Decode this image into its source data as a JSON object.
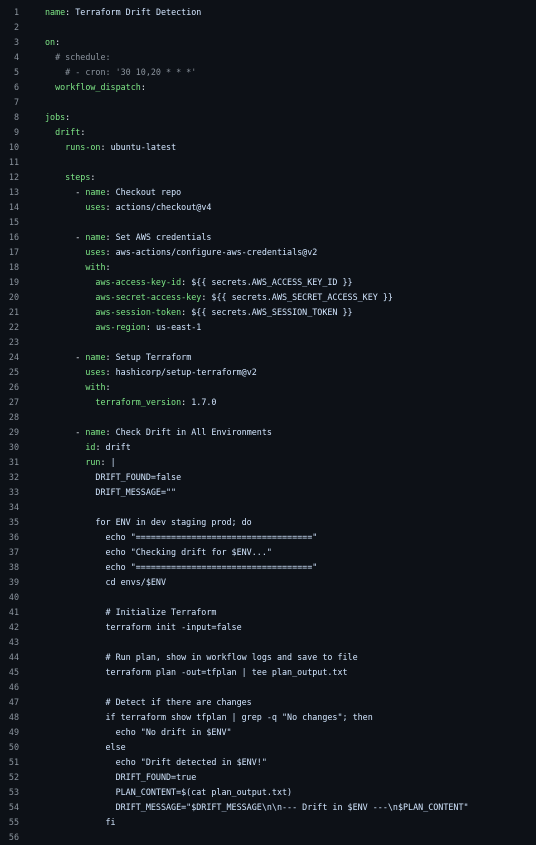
{
  "editor": {
    "lines": [
      {
        "n": "1",
        "t": [
          {
            "c": "k",
            "s": "name"
          },
          {
            "c": "p",
            "s": ": "
          },
          {
            "c": "v",
            "s": "Terraform Drift Detection"
          }
        ]
      },
      {
        "n": "2",
        "t": []
      },
      {
        "n": "3",
        "t": [
          {
            "c": "k",
            "s": "on"
          },
          {
            "c": "p",
            "s": ":"
          }
        ]
      },
      {
        "n": "4",
        "t": [
          {
            "c": "c",
            "s": "  # schedule:"
          }
        ]
      },
      {
        "n": "5",
        "t": [
          {
            "c": "c",
            "s": "    # - cron: '30 10,20 * * *'"
          }
        ]
      },
      {
        "n": "6",
        "t": [
          {
            "c": "p",
            "s": "  "
          },
          {
            "c": "k",
            "s": "workflow_dispatch"
          },
          {
            "c": "p",
            "s": ":"
          }
        ]
      },
      {
        "n": "7",
        "t": []
      },
      {
        "n": "8",
        "t": [
          {
            "c": "k",
            "s": "jobs"
          },
          {
            "c": "p",
            "s": ":"
          }
        ]
      },
      {
        "n": "9",
        "t": [
          {
            "c": "p",
            "s": "  "
          },
          {
            "c": "k",
            "s": "drift"
          },
          {
            "c": "p",
            "s": ":"
          }
        ]
      },
      {
        "n": "10",
        "t": [
          {
            "c": "p",
            "s": "    "
          },
          {
            "c": "k",
            "s": "runs-on"
          },
          {
            "c": "p",
            "s": ": "
          },
          {
            "c": "v",
            "s": "ubuntu-latest"
          }
        ]
      },
      {
        "n": "11",
        "t": []
      },
      {
        "n": "12",
        "t": [
          {
            "c": "p",
            "s": "    "
          },
          {
            "c": "k",
            "s": "steps"
          },
          {
            "c": "p",
            "s": ":"
          }
        ]
      },
      {
        "n": "13",
        "t": [
          {
            "c": "p",
            "s": "      - "
          },
          {
            "c": "k",
            "s": "name"
          },
          {
            "c": "p",
            "s": ": "
          },
          {
            "c": "v",
            "s": "Checkout repo"
          }
        ]
      },
      {
        "n": "14",
        "t": [
          {
            "c": "p",
            "s": "        "
          },
          {
            "c": "k",
            "s": "uses"
          },
          {
            "c": "p",
            "s": ": "
          },
          {
            "c": "v",
            "s": "actions/checkout@v4"
          }
        ]
      },
      {
        "n": "15",
        "t": []
      },
      {
        "n": "16",
        "t": [
          {
            "c": "p",
            "s": "      - "
          },
          {
            "c": "k",
            "s": "name"
          },
          {
            "c": "p",
            "s": ": "
          },
          {
            "c": "v",
            "s": "Set AWS credentials"
          }
        ]
      },
      {
        "n": "17",
        "t": [
          {
            "c": "p",
            "s": "        "
          },
          {
            "c": "k",
            "s": "uses"
          },
          {
            "c": "p",
            "s": ": "
          },
          {
            "c": "v",
            "s": "aws-actions/configure-aws-credentials@v2"
          }
        ]
      },
      {
        "n": "18",
        "t": [
          {
            "c": "p",
            "s": "        "
          },
          {
            "c": "k",
            "s": "with"
          },
          {
            "c": "p",
            "s": ":"
          }
        ]
      },
      {
        "n": "19",
        "t": [
          {
            "c": "p",
            "s": "          "
          },
          {
            "c": "k",
            "s": "aws-access-key-id"
          },
          {
            "c": "p",
            "s": ": "
          },
          {
            "c": "v",
            "s": "${{ secrets.AWS_ACCESS_KEY_ID }}"
          }
        ]
      },
      {
        "n": "20",
        "t": [
          {
            "c": "p",
            "s": "          "
          },
          {
            "c": "k",
            "s": "aws-secret-access-key"
          },
          {
            "c": "p",
            "s": ": "
          },
          {
            "c": "v",
            "s": "${{ secrets.AWS_SECRET_ACCESS_KEY }}"
          }
        ]
      },
      {
        "n": "21",
        "t": [
          {
            "c": "p",
            "s": "          "
          },
          {
            "c": "k",
            "s": "aws-session-token"
          },
          {
            "c": "p",
            "s": ": "
          },
          {
            "c": "v",
            "s": "${{ secrets.AWS_SESSION_TOKEN }}"
          }
        ]
      },
      {
        "n": "22",
        "t": [
          {
            "c": "p",
            "s": "          "
          },
          {
            "c": "k",
            "s": "aws-region"
          },
          {
            "c": "p",
            "s": ": "
          },
          {
            "c": "v",
            "s": "us-east-1"
          }
        ]
      },
      {
        "n": "23",
        "t": []
      },
      {
        "n": "24",
        "t": [
          {
            "c": "p",
            "s": "      - "
          },
          {
            "c": "k",
            "s": "name"
          },
          {
            "c": "p",
            "s": ": "
          },
          {
            "c": "v",
            "s": "Setup Terraform"
          }
        ]
      },
      {
        "n": "25",
        "t": [
          {
            "c": "p",
            "s": "        "
          },
          {
            "c": "k",
            "s": "uses"
          },
          {
            "c": "p",
            "s": ": "
          },
          {
            "c": "v",
            "s": "hashicorp/setup-terraform@v2"
          }
        ]
      },
      {
        "n": "26",
        "t": [
          {
            "c": "p",
            "s": "        "
          },
          {
            "c": "k",
            "s": "with"
          },
          {
            "c": "p",
            "s": ":"
          }
        ]
      },
      {
        "n": "27",
        "t": [
          {
            "c": "p",
            "s": "          "
          },
          {
            "c": "k",
            "s": "terraform_version"
          },
          {
            "c": "p",
            "s": ": "
          },
          {
            "c": "v",
            "s": "1.7.0"
          }
        ]
      },
      {
        "n": "28",
        "t": []
      },
      {
        "n": "29",
        "t": [
          {
            "c": "p",
            "s": "      - "
          },
          {
            "c": "k",
            "s": "name"
          },
          {
            "c": "p",
            "s": ": "
          },
          {
            "c": "v",
            "s": "Check Drift in All Environments"
          }
        ]
      },
      {
        "n": "30",
        "t": [
          {
            "c": "p",
            "s": "        "
          },
          {
            "c": "k",
            "s": "id"
          },
          {
            "c": "p",
            "s": ": "
          },
          {
            "c": "v",
            "s": "drift"
          }
        ]
      },
      {
        "n": "31",
        "t": [
          {
            "c": "p",
            "s": "        "
          },
          {
            "c": "k",
            "s": "run"
          },
          {
            "c": "p",
            "s": ": "
          },
          {
            "c": "v",
            "s": "|"
          }
        ]
      },
      {
        "n": "32",
        "t": [
          {
            "c": "v",
            "s": "          DRIFT_FOUND=false"
          }
        ]
      },
      {
        "n": "33",
        "t": [
          {
            "c": "v",
            "s": "          DRIFT_MESSAGE=\"\""
          }
        ]
      },
      {
        "n": "34",
        "t": []
      },
      {
        "n": "35",
        "t": [
          {
            "c": "v",
            "s": "          for ENV in dev staging prod; do"
          }
        ]
      },
      {
        "n": "36",
        "t": [
          {
            "c": "v",
            "s": "            echo \"===================================\""
          }
        ]
      },
      {
        "n": "37",
        "t": [
          {
            "c": "v",
            "s": "            echo \"Checking drift for $ENV...\""
          }
        ]
      },
      {
        "n": "38",
        "t": [
          {
            "c": "v",
            "s": "            echo \"===================================\""
          }
        ]
      },
      {
        "n": "39",
        "t": [
          {
            "c": "v",
            "s": "            cd envs/$ENV"
          }
        ]
      },
      {
        "n": "40",
        "t": []
      },
      {
        "n": "41",
        "t": [
          {
            "c": "v",
            "s": "            # Initialize Terraform"
          }
        ]
      },
      {
        "n": "42",
        "t": [
          {
            "c": "v",
            "s": "            terraform init -input=false"
          }
        ]
      },
      {
        "n": "43",
        "t": []
      },
      {
        "n": "44",
        "t": [
          {
            "c": "v",
            "s": "            # Run plan, show in workflow logs and save to file"
          }
        ]
      },
      {
        "n": "45",
        "t": [
          {
            "c": "v",
            "s": "            terraform plan -out=tfplan | tee plan_output.txt"
          }
        ]
      },
      {
        "n": "46",
        "t": []
      },
      {
        "n": "47",
        "t": [
          {
            "c": "v",
            "s": "            # Detect if there are changes"
          }
        ]
      },
      {
        "n": "48",
        "t": [
          {
            "c": "v",
            "s": "            if terraform show tfplan | grep -q \"No changes\"; then"
          }
        ]
      },
      {
        "n": "49",
        "t": [
          {
            "c": "v",
            "s": "              echo \"No drift in $ENV\""
          }
        ]
      },
      {
        "n": "50",
        "t": [
          {
            "c": "v",
            "s": "            else"
          }
        ]
      },
      {
        "n": "51",
        "t": [
          {
            "c": "v",
            "s": "              echo \"Drift detected in $ENV!\""
          }
        ]
      },
      {
        "n": "52",
        "t": [
          {
            "c": "v",
            "s": "              DRIFT_FOUND=true"
          }
        ]
      },
      {
        "n": "53",
        "t": [
          {
            "c": "v",
            "s": "              PLAN_CONTENT=$(cat plan_output.txt)"
          }
        ]
      },
      {
        "n": "54",
        "t": [
          {
            "c": "v",
            "s": "              DRIFT_MESSAGE=\"$DRIFT_MESSAGE\\n\\n--- Drift in $ENV ---\\n$PLAN_CONTENT\""
          }
        ]
      },
      {
        "n": "55",
        "t": [
          {
            "c": "v",
            "s": "            fi"
          }
        ]
      },
      {
        "n": "56",
        "t": []
      }
    ]
  },
  "colors": {
    "background": "#0d1117",
    "key": "#7ee787",
    "value": "#d2e6ff",
    "comment": "#8b949e",
    "line_number": "#8b949e"
  }
}
